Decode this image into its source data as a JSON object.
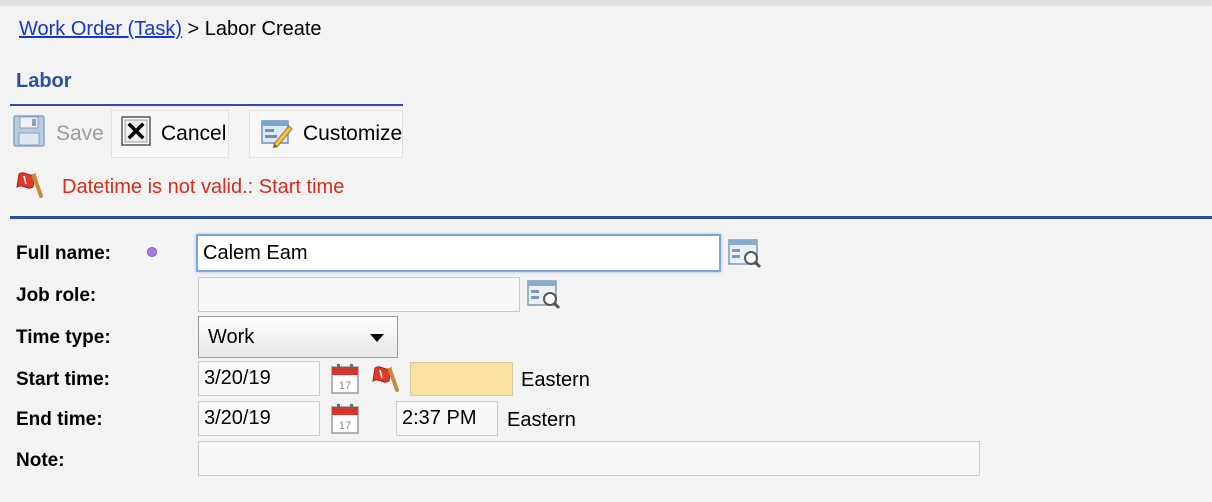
{
  "breadcrumb": {
    "link": "Work Order (Task)",
    "separator": ">",
    "current": "Labor Create"
  },
  "section": {
    "title": "Labor"
  },
  "toolbar": {
    "save_label": "Save",
    "cancel_label": "Cancel",
    "customize_label": "Customize"
  },
  "error": {
    "message": "Datetime is not valid.: Start time"
  },
  "form": {
    "full_name": {
      "label": "Full name:",
      "value": "Calem Eam"
    },
    "job_role": {
      "label": "Job role:",
      "value": ""
    },
    "time_type": {
      "label": "Time type:",
      "value": "Work"
    },
    "start_time": {
      "label": "Start time:",
      "date": "3/20/19",
      "time": "",
      "timezone": "Eastern"
    },
    "end_time": {
      "label": "End time:",
      "date": "3/20/19",
      "time": "2:37 PM",
      "timezone": "Eastern"
    },
    "note": {
      "label": "Note:",
      "value": ""
    }
  },
  "colors": {
    "link": "#1a35c4",
    "header_blue": "#2d4d9e",
    "error_red": "#d62b1a",
    "invalid_field": "#fae1a2"
  }
}
